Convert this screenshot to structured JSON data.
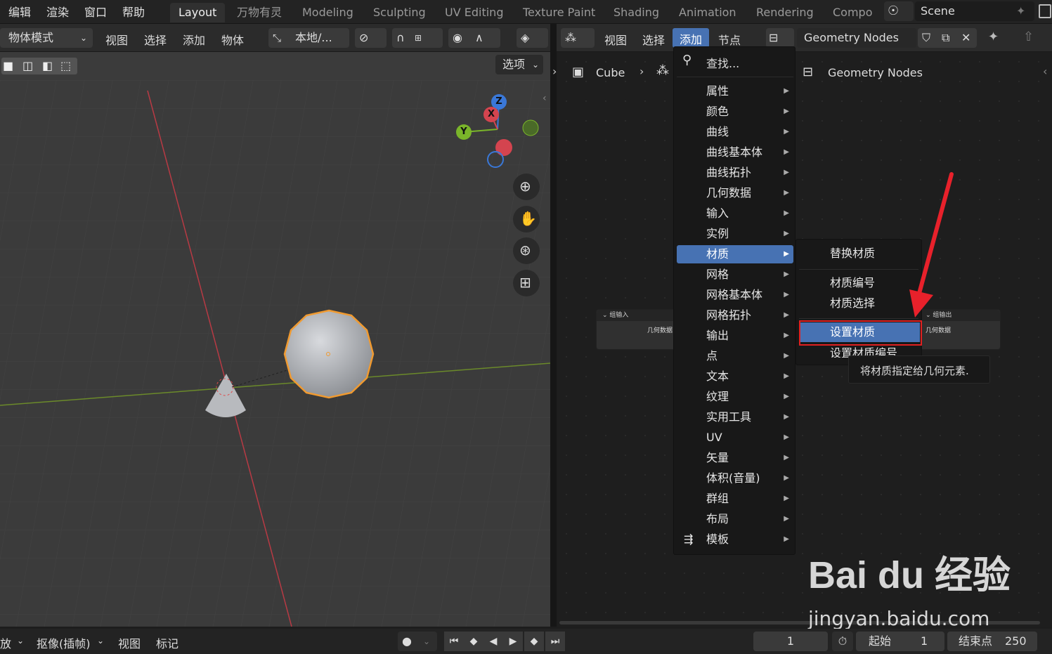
{
  "top_menu": [
    "编辑",
    "渲染",
    "窗口",
    "帮助"
  ],
  "workspace_tabs": [
    "Layout",
    "万物有灵",
    "Modeling",
    "Sculpting",
    "UV Editing",
    "Texture Paint",
    "Shading",
    "Animation",
    "Rendering",
    "Compo"
  ],
  "scene": "Scene",
  "viewport_header": {
    "mode": "物体模式",
    "menus": [
      "视图",
      "选择",
      "添加",
      "物体"
    ],
    "transform": "本地/...",
    "options": "选项"
  },
  "gizmo": {
    "z": "Z",
    "x": "X",
    "y": "Y"
  },
  "node_header": {
    "menus": [
      "视图",
      "选择",
      "添加",
      "节点"
    ],
    "tree_name": "Geometry Nodes"
  },
  "breadcrumb": {
    "object": "Cube",
    "tree": "Geometry Nodes"
  },
  "add_menu": {
    "search": "查找...",
    "items": [
      "属性",
      "颜色",
      "曲线",
      "曲线基本体",
      "曲线拓扑",
      "几何数据",
      "输入",
      "实例",
      "材质",
      "网格",
      "网格基本体",
      "网格拓扑",
      "输出",
      "点",
      "文本",
      "纹理",
      "实用工具",
      "UV",
      "矢量",
      "体积(音量)",
      "群组",
      "布局",
      "模板"
    ],
    "highlighted": "材质"
  },
  "material_submenu": {
    "items": [
      "替换材质",
      "材质编号",
      "材质选择",
      "设置材质",
      "设置材质编号"
    ],
    "highlighted": "设置材质"
  },
  "tooltip": "将材质指定给几何元素.",
  "nodes": {
    "group_input": {
      "title": "组输入",
      "socket": "几何数据"
    },
    "group_output": {
      "title": "组输出",
      "socket": "几何数据"
    }
  },
  "bottom": {
    "playback": "放",
    "keying": "抠像(插帧)",
    "view": "视图",
    "marker": "标记",
    "current_frame": "1",
    "start_label": "起始",
    "start": "1",
    "end_label": "结束点",
    "end": "250"
  },
  "watermark": {
    "brand": "Bai du 经验",
    "url": "jingyan.baidu.com"
  }
}
